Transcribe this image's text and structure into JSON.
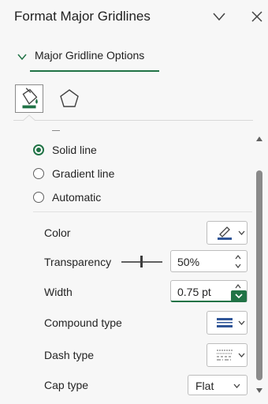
{
  "pane": {
    "title": "Format Major Gridlines",
    "section_title": "Major Gridline Options",
    "tabs": [
      {
        "icon": "paint-bucket-icon",
        "label": "Fill & Line",
        "selected": true
      },
      {
        "icon": "pentagon-icon",
        "label": "Effects",
        "selected": false
      }
    ]
  },
  "line": {
    "options": [
      {
        "label": "Solid line",
        "checked": true
      },
      {
        "label": "Gradient line",
        "checked": false
      },
      {
        "label": "Automatic",
        "checked": false
      }
    ]
  },
  "props": {
    "color_label": "Color",
    "transparency_label": "Transparency",
    "transparency_value": "50%",
    "width_label": "Width",
    "width_value": "0.75 pt",
    "compound_label": "Compound type",
    "dash_label": "Dash type",
    "cap_label": "Cap type",
    "cap_value": "Flat"
  },
  "colors": {
    "accent_green": "#217346",
    "line_blue": "#2f5597"
  }
}
